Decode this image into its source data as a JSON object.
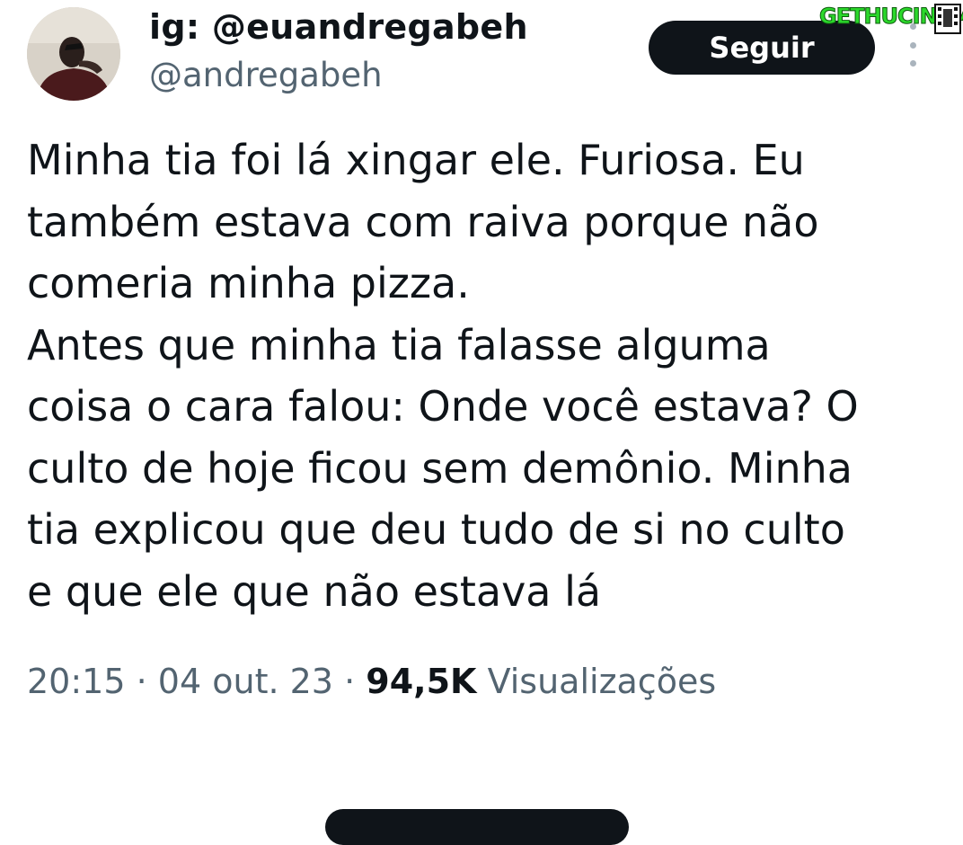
{
  "author": {
    "display_name": "ig: @euandregabeh",
    "handle": "@andregabeh"
  },
  "follow_button": {
    "label": "Seguir"
  },
  "tweet": {
    "lines": [
      "Minha tia foi lá xingar ele. Furiosa. Eu",
      "também estava com raiva porque não",
      "comeria minha pizza.",
      "Antes que minha tia falasse alguma",
      "coisa o cara falou: Onde você estava? O",
      "culto de hoje ficou sem demônio. Minha",
      "tia explicou que deu tudo de si no culto",
      "e que ele que não estava lá"
    ]
  },
  "meta": {
    "time": "20:15",
    "separator": "·",
    "date": "04 out. 23",
    "views_count": "94,5K",
    "views_label": "Visualizações"
  },
  "watermark": {
    "text": "GETHUCINEMA"
  },
  "icons": {
    "avatar": "profile-photo",
    "more": "vertical-ellipsis-icon",
    "watermark_logo": "film-strip-icon"
  },
  "colors": {
    "text_primary": "#0f1419",
    "text_secondary": "#536471",
    "button_bg": "#0f1419",
    "button_text": "#ffffff",
    "watermark": "#2bd82b"
  }
}
